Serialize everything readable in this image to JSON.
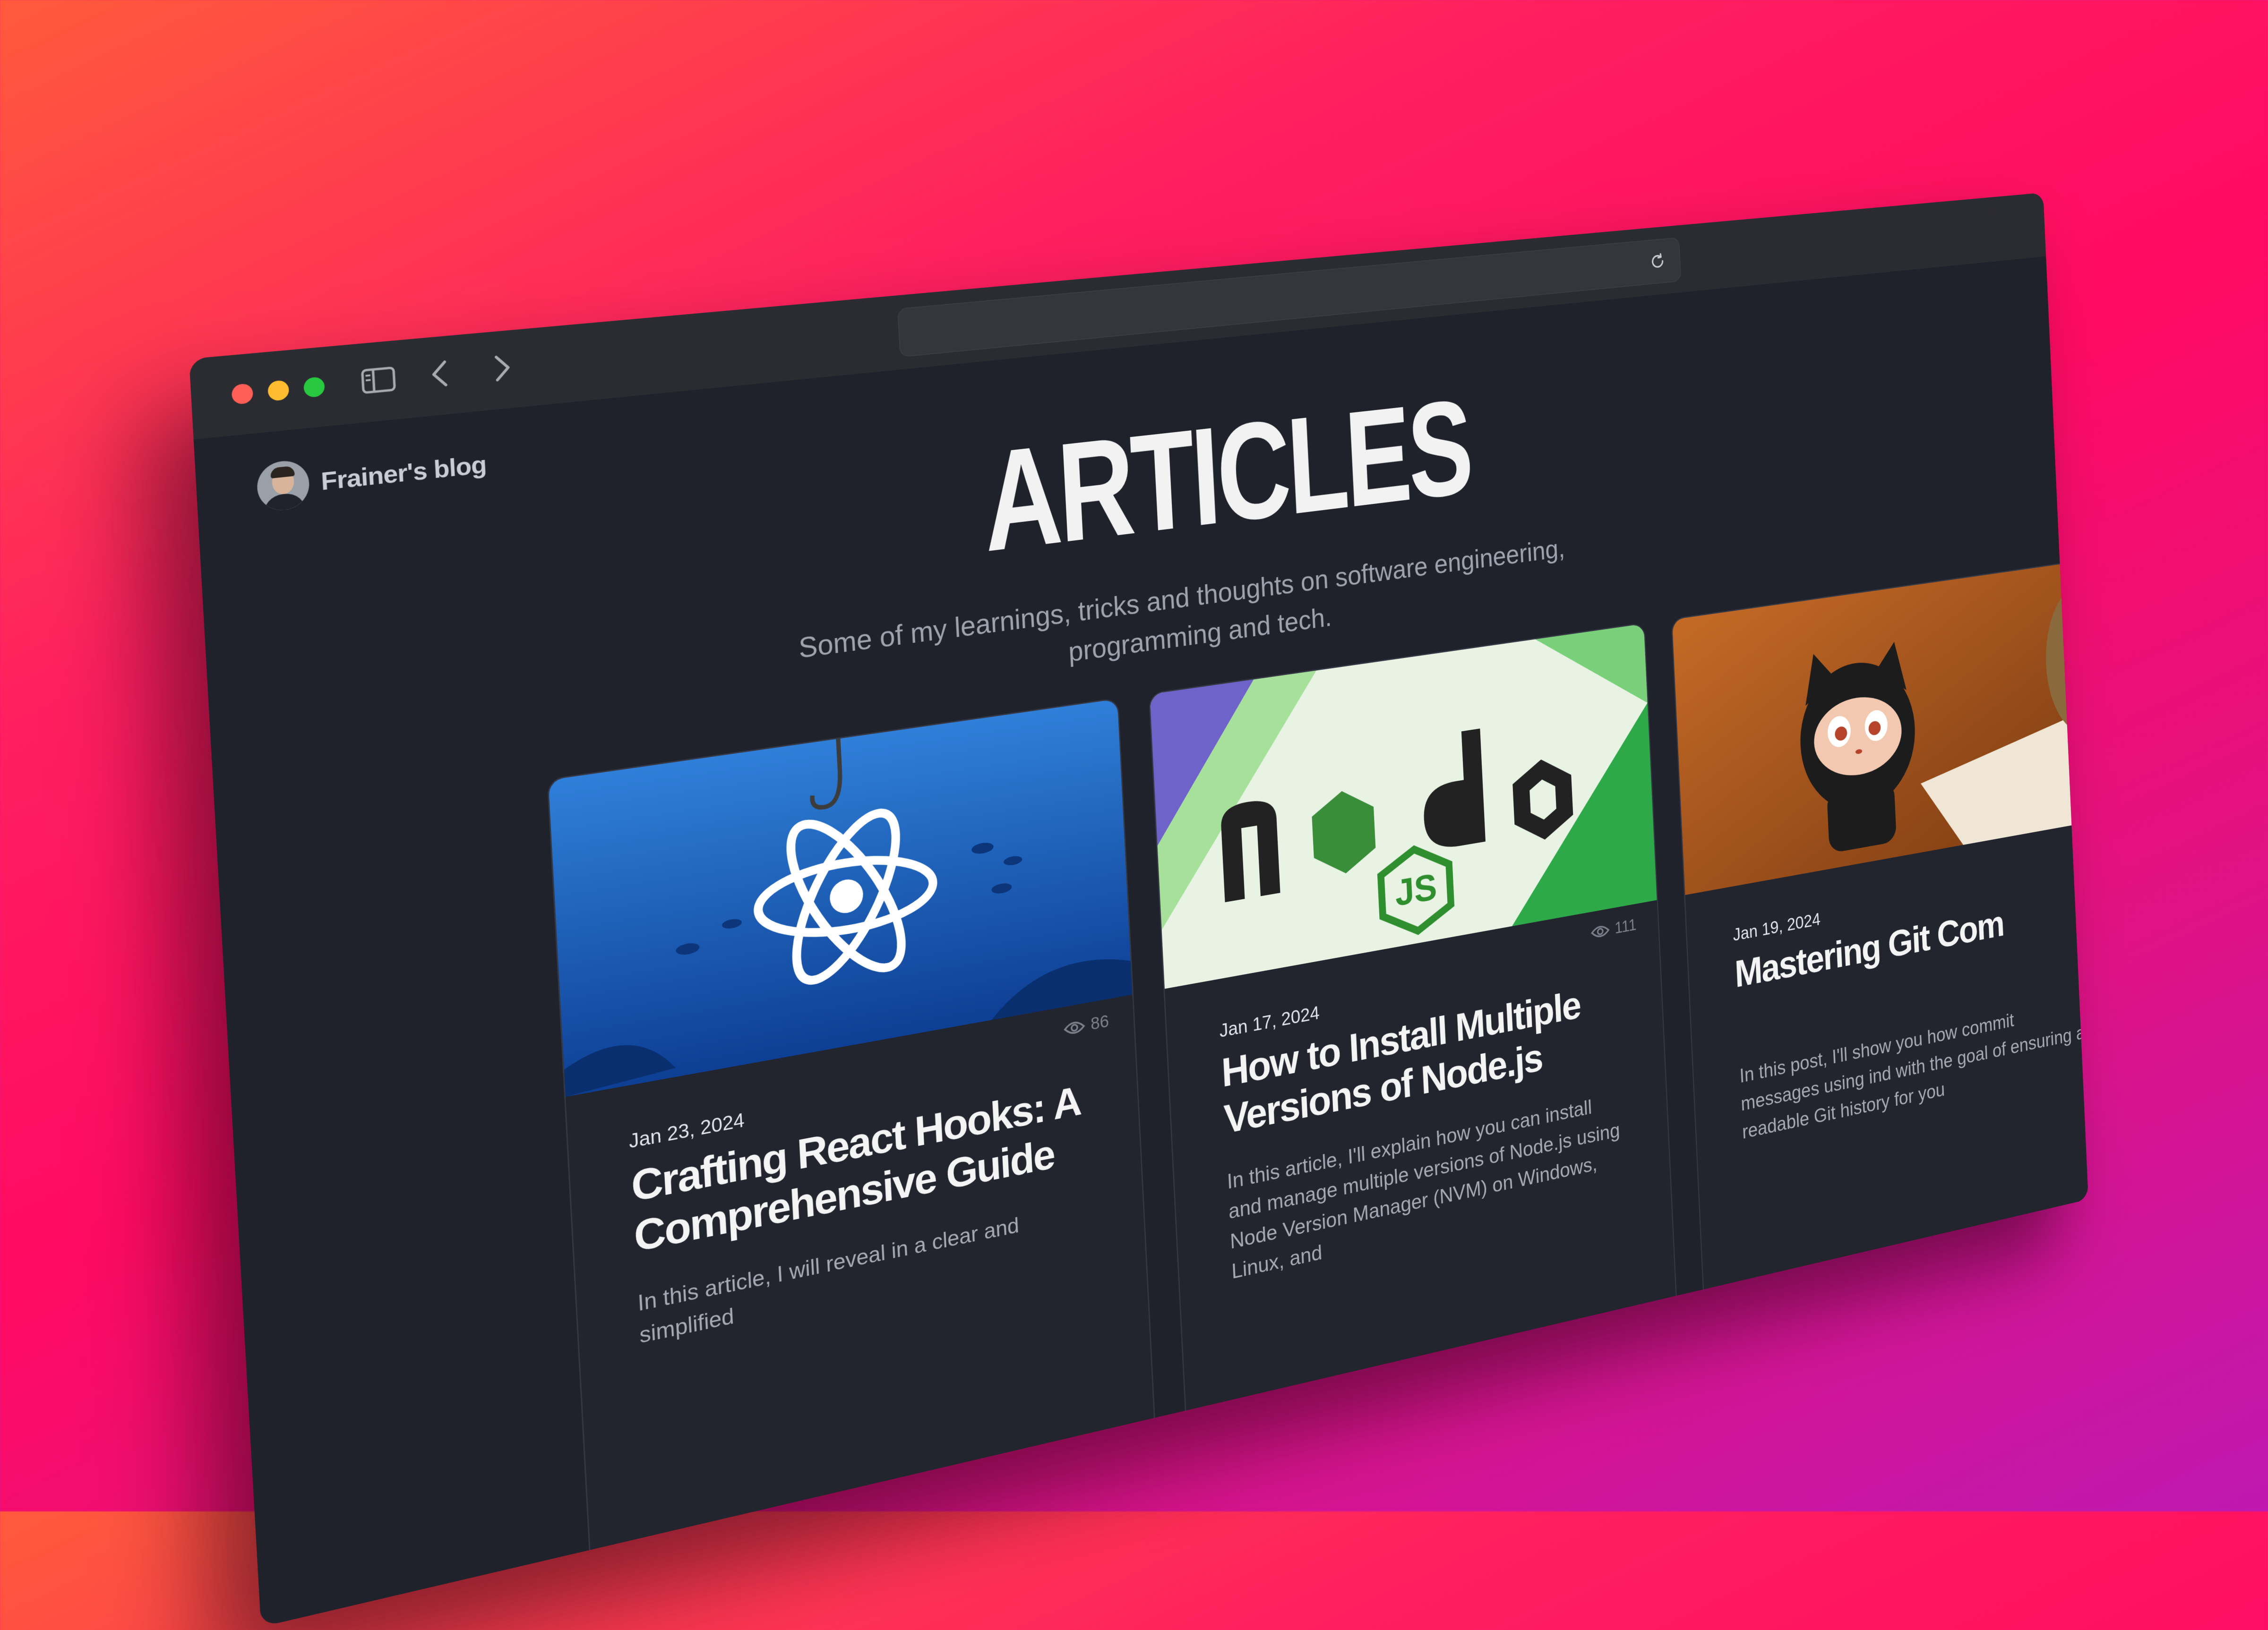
{
  "browser": {
    "traffic_lights": {
      "close": "#ff5f57",
      "minimize": "#febc2e",
      "zoom": "#28c840"
    }
  },
  "blog": {
    "name": "Frainer's blog"
  },
  "page": {
    "title": "ARTICLES",
    "subtitle": "Some of my learnings, tricks and thoughts on software engineering, programming and tech."
  },
  "articles": [
    {
      "date": "Jan 23, 2024",
      "views": "86",
      "title": "Crafting React Hooks: A Comprehensive Guide",
      "excerpt": "In this article, I will reveal in a clear and simplified",
      "image": "react-logo"
    },
    {
      "date": "Jan 17, 2024",
      "views": "111",
      "title": "How to Install Multiple Versions of Node.js",
      "excerpt": "In this article, I'll explain how you can install and manage multiple versions of Node.js using Node Version Manager (NVM) on Windows, Linux, and",
      "image": "nodejs-logo"
    },
    {
      "date": "Jan 19, 2024",
      "views": "",
      "title": "Mastering Git Com",
      "excerpt": "In this post, I'll show you how commit messages using ind with the goal of ensuring a readable Git history for you",
      "image": "octocat-figure"
    }
  ]
}
